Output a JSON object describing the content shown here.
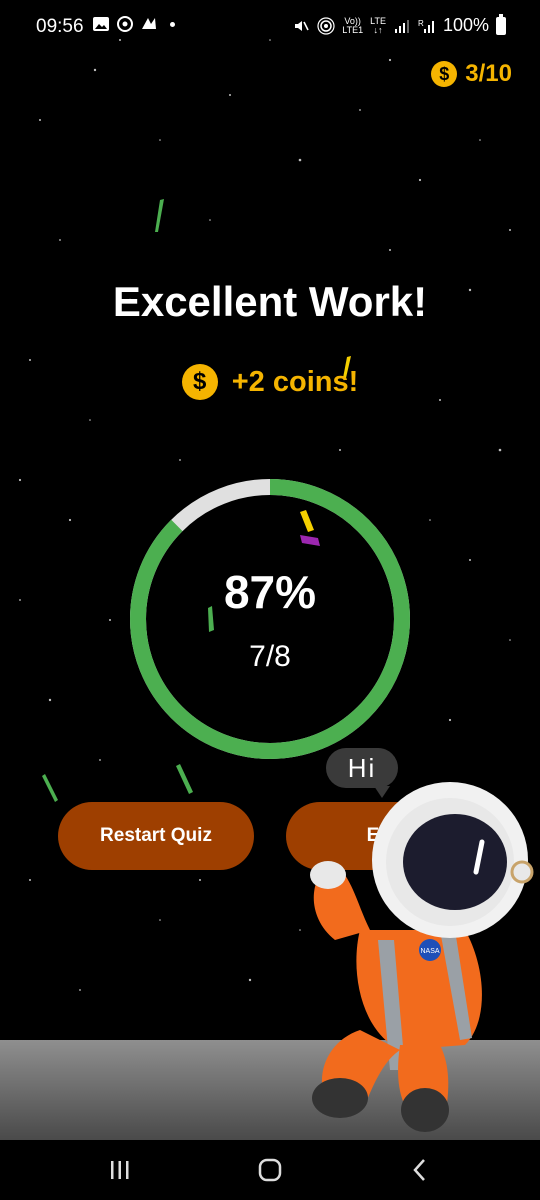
{
  "status_bar": {
    "time": "09:56",
    "battery_text": "100%",
    "volte_label": "Vo))\nLTE1",
    "lte_label": "LTE\n↓↑",
    "sim_label": "R"
  },
  "coins": {
    "count_text": "3/10",
    "icon": "dollar-coin-icon",
    "coin_symbol": "$"
  },
  "result": {
    "title": "Excellent Work!",
    "reward_text": "+2 coins!",
    "percent_text": "87%",
    "score_text": "7/8",
    "progress_fraction": 0.875,
    "progress_color": "#4caf50",
    "track_color": "#e0e0e0"
  },
  "buttons": {
    "restart_label": "Restart Quiz",
    "exit_label": "Exit",
    "color": "#9e3f00"
  },
  "mascot": {
    "speech": "Hi",
    "badge_text": "NASA"
  },
  "nav": {
    "recent_icon": "recent-apps-icon",
    "home_icon": "home-icon",
    "back_icon": "back-icon"
  },
  "accent_color": "#f5b400"
}
